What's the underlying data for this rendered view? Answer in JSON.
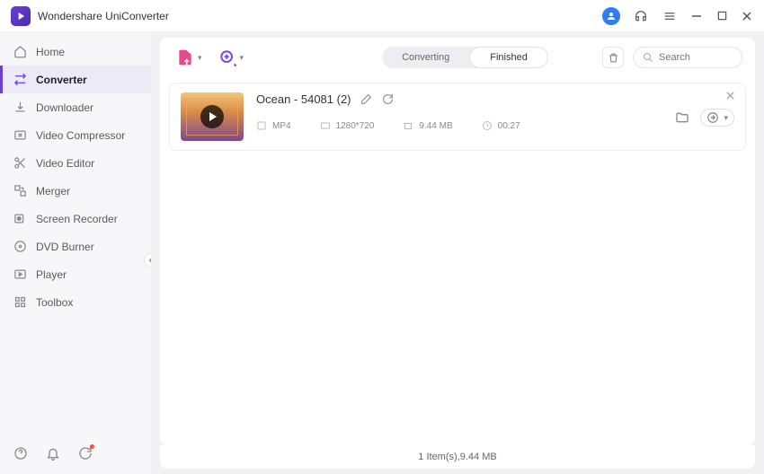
{
  "app": {
    "title": "Wondershare UniConverter"
  },
  "sidebar": {
    "items": [
      {
        "label": "Home"
      },
      {
        "label": "Converter"
      },
      {
        "label": "Downloader"
      },
      {
        "label": "Video Compressor"
      },
      {
        "label": "Video Editor"
      },
      {
        "label": "Merger"
      },
      {
        "label": "Screen Recorder"
      },
      {
        "label": "DVD Burner"
      },
      {
        "label": "Player"
      },
      {
        "label": "Toolbox"
      }
    ]
  },
  "tabs": {
    "converting": "Converting",
    "finished": "Finished"
  },
  "search": {
    "placeholder": "Search"
  },
  "file": {
    "title": "Ocean - 54081 (2)",
    "format": "MP4",
    "resolution": "1280*720",
    "size": "9.44 MB",
    "duration": "00:27"
  },
  "status": {
    "summary": "1 Item(s),9.44 MB"
  }
}
